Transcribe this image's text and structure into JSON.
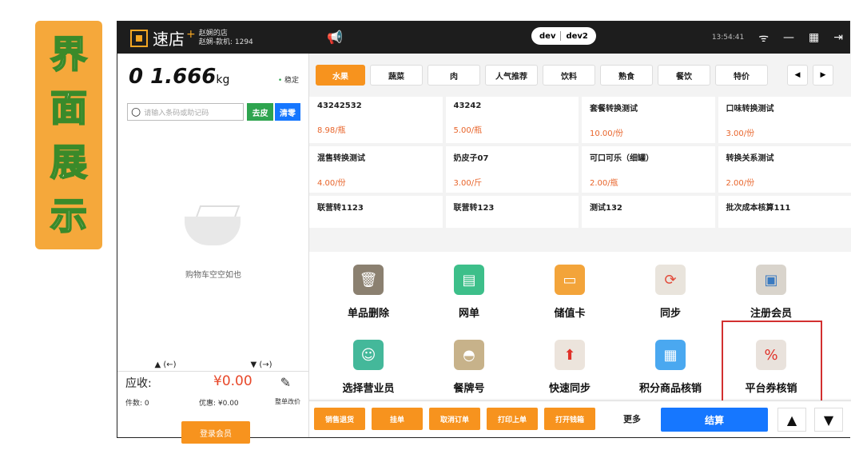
{
  "side_tag": [
    "界",
    "面",
    "展",
    "示"
  ],
  "topbar": {
    "app_name": "速店",
    "store": "赵娴的店",
    "register": "赵娴-款机: 1294",
    "dev_tags": [
      "dev",
      "dev2"
    ],
    "time": "13:54:41"
  },
  "left": {
    "weight": "0 1.666",
    "unit": "kg",
    "stable": "稳定",
    "search_placeholder": "请输入条码或助记码",
    "peel": "去皮",
    "clear": "清零",
    "empty_text": "购物车空空如也",
    "up": "▲ (←)",
    "down": "▼ (→)",
    "due_label": "应收:",
    "due_value": "¥0.00",
    "count": "件数: 0",
    "discount": "优惠: ¥0.00",
    "whole_change": "整单改价",
    "login_member": "登录会员"
  },
  "categories": [
    "水果",
    "蔬菜",
    "肉",
    "人气推荐",
    "饮料",
    "熟食",
    "餐饮",
    "特价"
  ],
  "products": [
    {
      "name": "43242532",
      "price": "8.98/瓶"
    },
    {
      "name": "43242",
      "price": "5.00/瓶"
    },
    {
      "name": "套餐转换测试",
      "price": "10.00/份"
    },
    {
      "name": "口味转换测试",
      "price": "3.00/份"
    },
    {
      "name": "混售转换测试",
      "price": "4.00/份"
    },
    {
      "name": "奶皮子07",
      "price": "3.00/斤"
    },
    {
      "name": "可口可乐（细罐）",
      "price": "2.00/瓶"
    },
    {
      "name": "转换关系测试",
      "price": "2.00/份"
    },
    {
      "name": "联营转1123",
      "price": ""
    },
    {
      "name": "联营转123",
      "price": ""
    },
    {
      "name": "测试132",
      "price": ""
    },
    {
      "name": "批次成本核算111",
      "price": ""
    }
  ],
  "functions": [
    {
      "label": "单品删除",
      "icon": "trash-icon",
      "color": "#8b8070"
    },
    {
      "label": "网单",
      "icon": "document-icon",
      "color": "#3dbf8a"
    },
    {
      "label": "储值卡",
      "icon": "card-icon",
      "color": "#f3a43a"
    },
    {
      "label": "同步",
      "icon": "sync-icon",
      "color": "#e9e4dc"
    },
    {
      "label": "注册会员",
      "icon": "monitor-icon",
      "color": "#d9d4cc"
    },
    {
      "label": "选择营业员",
      "icon": "person-icon",
      "color": "#44b89a"
    },
    {
      "label": "餐牌号",
      "icon": "cloche-icon",
      "color": "#c7b28a"
    },
    {
      "label": "快速同步",
      "icon": "up-arrow-icon",
      "color": "#ece4dc"
    },
    {
      "label": "积分商品核销",
      "icon": "qrcode-icon",
      "color": "#4aa8f0"
    },
    {
      "label": "平台券核销",
      "icon": "coupon-icon",
      "color": "#e9e2dc"
    }
  ],
  "bottom": {
    "buttons": [
      "销售退货",
      "挂单",
      "取消订单",
      "打印上单",
      "打开钱箱"
    ],
    "more": "更多",
    "checkout": "结算"
  }
}
